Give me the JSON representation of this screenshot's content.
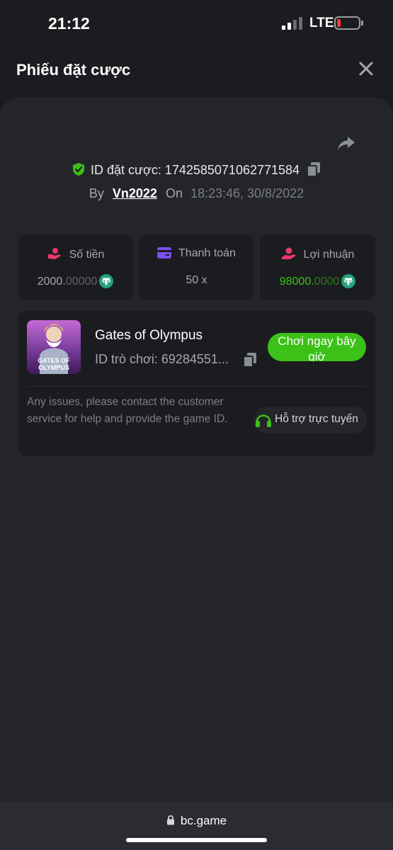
{
  "status_bar": {
    "time": "21:12",
    "network": "LTE"
  },
  "header": {
    "title": "Phiếu đặt cược"
  },
  "bet": {
    "id_text": "ID đặt cược: 1742585071062771584",
    "by_label": "By",
    "user": "Vn2022",
    "on_label": "On",
    "datetime": "18:23:46, 30/8/2022"
  },
  "stats": {
    "amount": {
      "label": "Số tiền",
      "value_main": "2000.",
      "value_dim": "00000",
      "icon": "money-bag-icon",
      "color": "#e9386b"
    },
    "payout": {
      "label": "Thanh toán",
      "value": "50 x",
      "icon": "card-icon",
      "color": "#7b4ef4"
    },
    "profit": {
      "label": "Lợi nhuận",
      "value_main": "98000.",
      "value_dim": "0000",
      "icon": "hand-coins-icon",
      "color": "#e9386b",
      "value_color": "#3bc117"
    },
    "currency_icon": "usdt-icon"
  },
  "game": {
    "name": "Gates of Olympus",
    "id_text": "ID trò chơi: 69284551...",
    "thumb_line1": "GATES OF",
    "thumb_line2": "OLYMPUS",
    "play_label": "Chơi ngay bây giờ"
  },
  "help": {
    "text": "Any issues, please contact the customer service for help and provide the game ID.",
    "support_label": "Hỗ trợ trực tuyến"
  },
  "browser": {
    "url": "bc.game"
  },
  "colors": {
    "accent_green": "#3bc117",
    "background": "#1b1c1f",
    "panel": "#232529"
  }
}
